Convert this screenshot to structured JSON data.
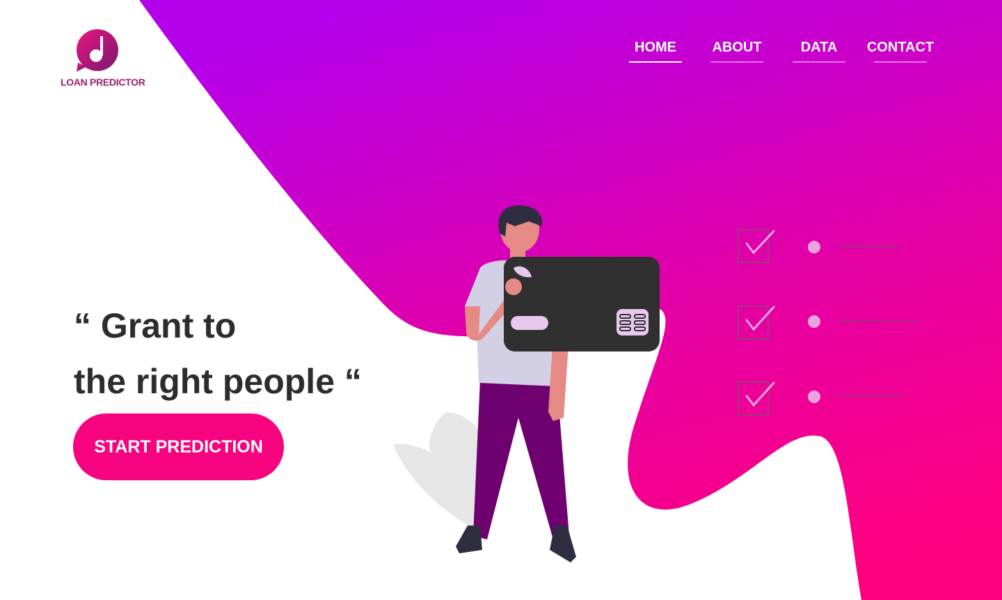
{
  "brand": {
    "name": "LOAN PREDICTOR",
    "logo_icon": "music-note-chat-bubble-icon",
    "color": "#9b1f6d"
  },
  "nav": {
    "items": [
      {
        "label": "HOME",
        "active": true
      },
      {
        "label": "ABOUT",
        "active": false
      },
      {
        "label": "DATA",
        "active": false
      },
      {
        "label": "CONTACT",
        "active": false
      }
    ]
  },
  "hero": {
    "line1": "“ Grant to",
    "line2": "the right people “",
    "cta_label": "START PREDICTION"
  },
  "illustration": {
    "subject": "person-holding-credit-card",
    "checklist_items": 3
  },
  "colors": {
    "gradient_top": "#b400ea",
    "gradient_bottom": "#ff0080",
    "accent": "#f7037f",
    "text_dark": "#2d2d2d"
  }
}
